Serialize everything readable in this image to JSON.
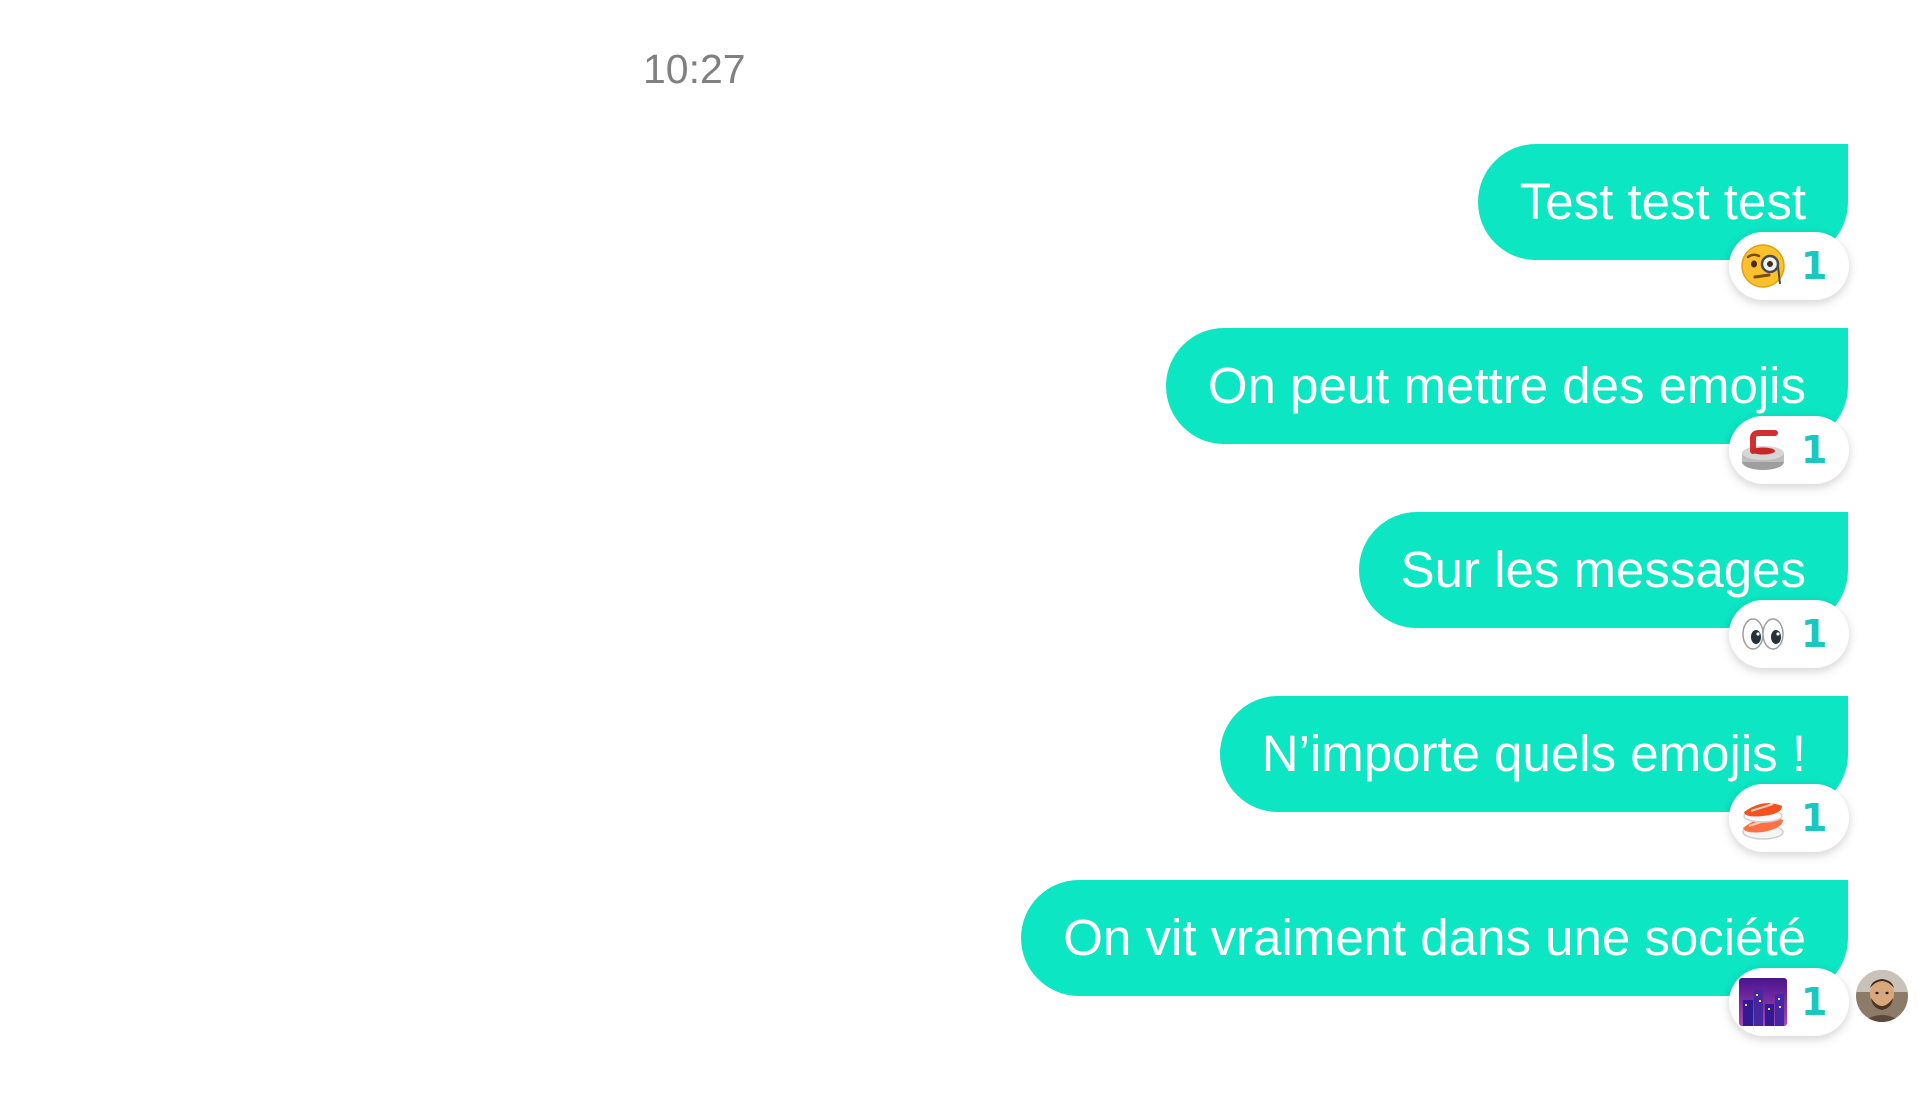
{
  "conversation": {
    "timestamp": "10:27",
    "accent_color": "#0de6c3",
    "count_color": "#17c9c1",
    "messages": [
      {
        "text": "Test test test",
        "reaction_icon": "face-with-monocle-icon",
        "reaction_count": "1"
      },
      {
        "text": "On peut mettre des emojis",
        "reaction_icon": "curling-stone-icon",
        "reaction_count": "1"
      },
      {
        "text": "Sur les messages",
        "reaction_icon": "eyes-icon",
        "reaction_count": "1"
      },
      {
        "text": "N’importe quels emojis !",
        "reaction_icon": "sushi-icon",
        "reaction_count": "1"
      },
      {
        "text": "On vit vraiment dans une société",
        "reaction_icon": "night-city-icon",
        "reaction_count": "1"
      }
    ],
    "seen_avatar_icon": "user-avatar-icon"
  }
}
